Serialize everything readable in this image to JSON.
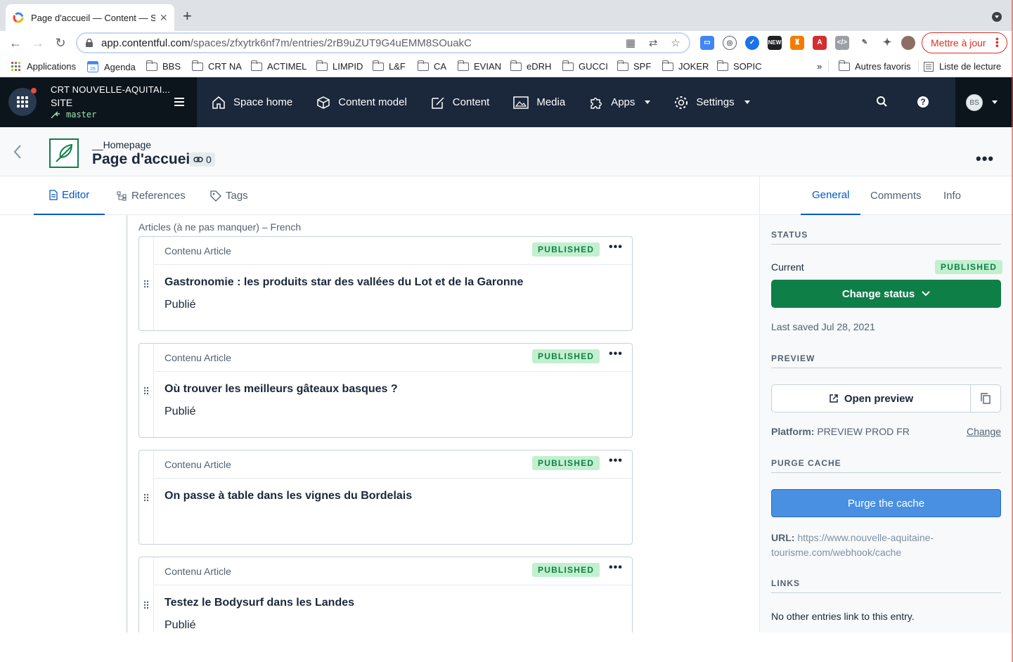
{
  "browser": {
    "tab_title": "Page d'accueil — Content — SI",
    "url_domain": "app.contentful.com",
    "url_path": "/spaces/zfxytrk6nf7m/entries/2rB9uZUT9G4uEMM8SOuakC",
    "update_button": "Mettre à jour",
    "bookmarks": [
      "Applications",
      "Agenda",
      "BBS",
      "CRT NA",
      "ACTIMEL",
      "LIMPID",
      "L&F",
      "CA",
      "EVIAN",
      "eDRH",
      "GUCCI",
      "SPF",
      "JOKER",
      "SOPIC"
    ],
    "bookmarks_overflow": "»",
    "other_bookmarks": "Autres favoris",
    "reading_list": "Liste de lecture"
  },
  "app": {
    "space_name": "CRT NOUVELLE-AQUITAI...",
    "environment": "SITE",
    "branch": "master",
    "nav": [
      "Space home",
      "Content model",
      "Content",
      "Media",
      "Apps",
      "Settings"
    ],
    "user_initials": "BS"
  },
  "entry": {
    "content_type": "__Homepage",
    "title": "Page d'accueil",
    "link_count": "0"
  },
  "editor_tabs": [
    "Editor",
    "References",
    "Tags"
  ],
  "field": {
    "label": "Articles (à ne pas manquer) – French",
    "cards": [
      {
        "type": "Contenu Article",
        "badge": "PUBLISHED",
        "title": "Gastronomie : les produits star des vallées du Lot et de la Garonne",
        "status": "Publié"
      },
      {
        "type": "Contenu Article",
        "badge": "PUBLISHED",
        "title": "Où trouver les meilleurs gâteaux basques ?",
        "status": "Publié"
      },
      {
        "type": "Contenu Article",
        "badge": "PUBLISHED",
        "title": "On passe à table dans les vignes du Bordelais",
        "status": ""
      },
      {
        "type": "Contenu Article",
        "badge": "PUBLISHED",
        "title": "Testez le Bodysurf dans les Landes",
        "status": "Publié"
      }
    ]
  },
  "sidebar": {
    "tabs": [
      "General",
      "Comments",
      "Info"
    ],
    "status_heading": "STATUS",
    "current_label": "Current",
    "current_badge": "PUBLISHED",
    "change_status": "Change status",
    "last_saved": "Last saved Jul 28, 2021",
    "preview_heading": "PREVIEW",
    "open_preview": "Open preview",
    "platform_label": "Platform:",
    "platform_value": "PREVIEW PROD FR",
    "platform_change": "Change",
    "purge_heading": "PURGE CACHE",
    "purge_button": "Purge the cache",
    "url_label": "URL:",
    "url_value_1": "https://www.nouvelle-aquitaine-",
    "url_value_2": "tourisme.com/webhook/cache",
    "links_heading": "LINKS",
    "links_text": "No other entries link to this entry."
  },
  "colors": {
    "accent": "#0059c8",
    "published_bg": "#c2f0cf",
    "published_fg": "#0e7f47",
    "header_bg": "#1b273a",
    "purge_blue": "#4a90e2"
  }
}
